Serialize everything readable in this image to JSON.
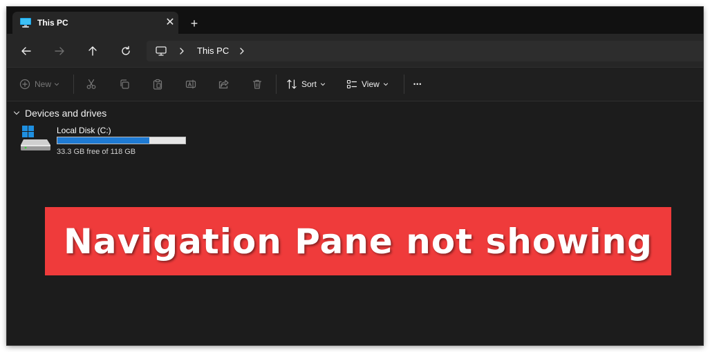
{
  "window": {
    "tab": {
      "title": "This PC",
      "close_glyph": "✕",
      "icon": "monitor-icon"
    },
    "new_tab_glyph": "+"
  },
  "nav": {
    "back_icon": "arrow-left-icon",
    "forward_icon": "arrow-right-icon",
    "up_icon": "arrow-up-icon",
    "refresh_icon": "refresh-icon",
    "breadcrumb": {
      "location": "This PC",
      "icon": "monitor-icon"
    }
  },
  "toolbar": {
    "new_label": "New",
    "sort_label": "Sort",
    "view_label": "View",
    "more_glyph": "•••",
    "icons": [
      "plus-circle-icon",
      "cut-icon",
      "copy-icon",
      "paste-icon",
      "rename-icon",
      "share-icon",
      "delete-icon",
      "sort-icon",
      "view-icon",
      "more-icon"
    ]
  },
  "content": {
    "group_title": "Devices and drives",
    "drives": [
      {
        "name": "Local Disk (C:)",
        "free_text": "33.3 GB free of 118 GB",
        "used_fraction": 0.718
      }
    ]
  },
  "banner": {
    "text": "Navigation Pane not showing"
  },
  "colors": {
    "accent": "#1e7ad3",
    "banner": "#ef3b3b",
    "window_bg": "#1c1c1c",
    "tabstrip_bg": "#111111"
  }
}
